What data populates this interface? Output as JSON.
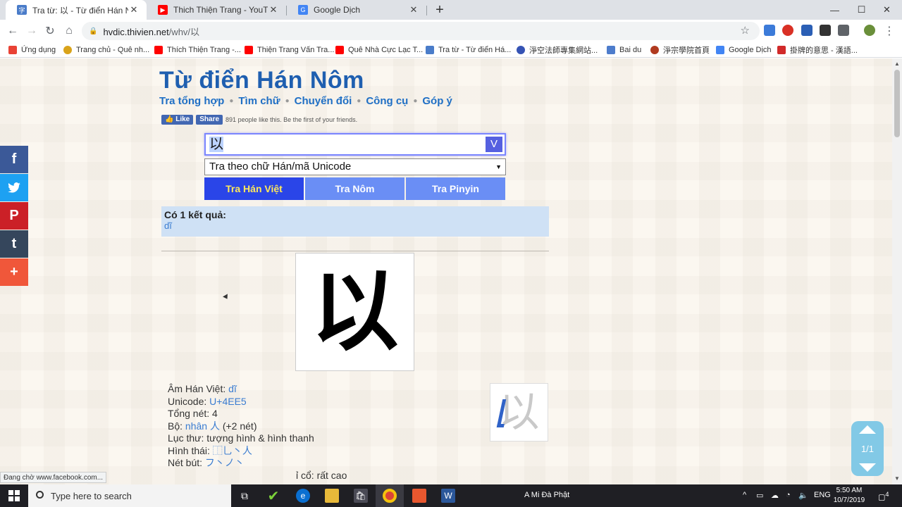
{
  "browser": {
    "tabs": [
      {
        "title": "Tra từ: 以 - Từ điển Hán Nôm",
        "active": true,
        "favicon": "hvdic-icon"
      },
      {
        "title": "Thich Thiện Trang - YouTube",
        "active": false,
        "favicon": "youtube-icon"
      },
      {
        "title": "Google Dịch",
        "active": false,
        "favicon": "google-translate-icon"
      }
    ],
    "new_tab": "+",
    "window_controls": {
      "minimize": "—",
      "maximize": "☐",
      "close": "✕"
    },
    "url_host": "hvdic.thivien.net",
    "url_path": "/whv/以",
    "bookmarks": [
      {
        "label": "Ứng dụng",
        "color": "#e94235"
      },
      {
        "label": "Trang chủ - Quê nh...",
        "color": "#d9a31a"
      },
      {
        "label": "Thích Thiện Trang -...",
        "color": "#ff0000"
      },
      {
        "label": "Thiện Trang Vấn Tra...",
        "color": "#ff0000"
      },
      {
        "label": "Quê Nhà Cực Lạc T...",
        "color": "#ff0000"
      },
      {
        "label": "Tra từ - Từ điển Há...",
        "color": "#4a7cc9"
      },
      {
        "label": "淨空法師專集網站...",
        "color": "#3553b4"
      },
      {
        "label": "Bai du",
        "color": "#4d7ccc"
      },
      {
        "label": "淨宗學院首頁",
        "color": "#b03a1f"
      },
      {
        "label": "Google Dịch",
        "color": "#4285f4"
      },
      {
        "label": "掛牌的意思 - 漢語...",
        "color": "#d12a2a"
      }
    ]
  },
  "site": {
    "title": "Từ điển Hán Nôm",
    "nav": [
      "Tra tổng hợp",
      "Tìm chữ",
      "Chuyển đổi",
      "Công cụ",
      "Góp ý"
    ],
    "fb_like": "Like",
    "fb_share": "Share",
    "fb_text": "891 people like this. Be the first of your friends."
  },
  "search": {
    "value": "以",
    "v_button": "V",
    "mode_select": "Tra theo chữ Hán/mã Unicode",
    "buttons": [
      "Tra Hán Việt",
      "Tra Nôm",
      "Tra Pinyin"
    ]
  },
  "result": {
    "header": "Có 1 kết quả:",
    "items": [
      "dĩ"
    ]
  },
  "character": {
    "glyph": "以",
    "info": {
      "am_label": "Âm Hán Việt:",
      "am_value": "dĩ",
      "unicode_label": "Unicode:",
      "unicode_value": "U+4EE5",
      "strokes_label": "Tổng nét:",
      "strokes_value": "4",
      "radical_label": "Bộ:",
      "radical_value": "nhân 人",
      "radical_extra": "(+2 nét)",
      "luc_thu_label": "Lục thư:",
      "luc_thu_value": "tượng hình & hình thanh",
      "hinh_thai_label": "Hình thái:",
      "hinh_thai_value": "⿰⺃丶人",
      "net_but_label": "Nét bút:",
      "net_but_value": "フ丶ノ丶",
      "partial_line": "ỉ cổ: rất cao"
    }
  },
  "pager": {
    "label": "1/1"
  },
  "statusbar": "Đang chờ www.facebook.com...",
  "social": [
    {
      "name": "facebook-share",
      "glyph": "f",
      "color": "#3b5998"
    },
    {
      "name": "twitter-share",
      "glyph": "🐦",
      "color": "#1da1f2"
    },
    {
      "name": "pinterest-share",
      "glyph": "P",
      "color": "#cb2027"
    },
    {
      "name": "tumblr-share",
      "glyph": "t",
      "color": "#35465c"
    },
    {
      "name": "more-share",
      "glyph": "+",
      "color": "#f0573a"
    }
  ],
  "taskbar": {
    "search_placeholder": "Type here to search",
    "running_label": "A Mi Đà Phật",
    "lang": "ENG",
    "time": "5:50 AM",
    "date": "10/7/2019",
    "notification_count": "4"
  }
}
